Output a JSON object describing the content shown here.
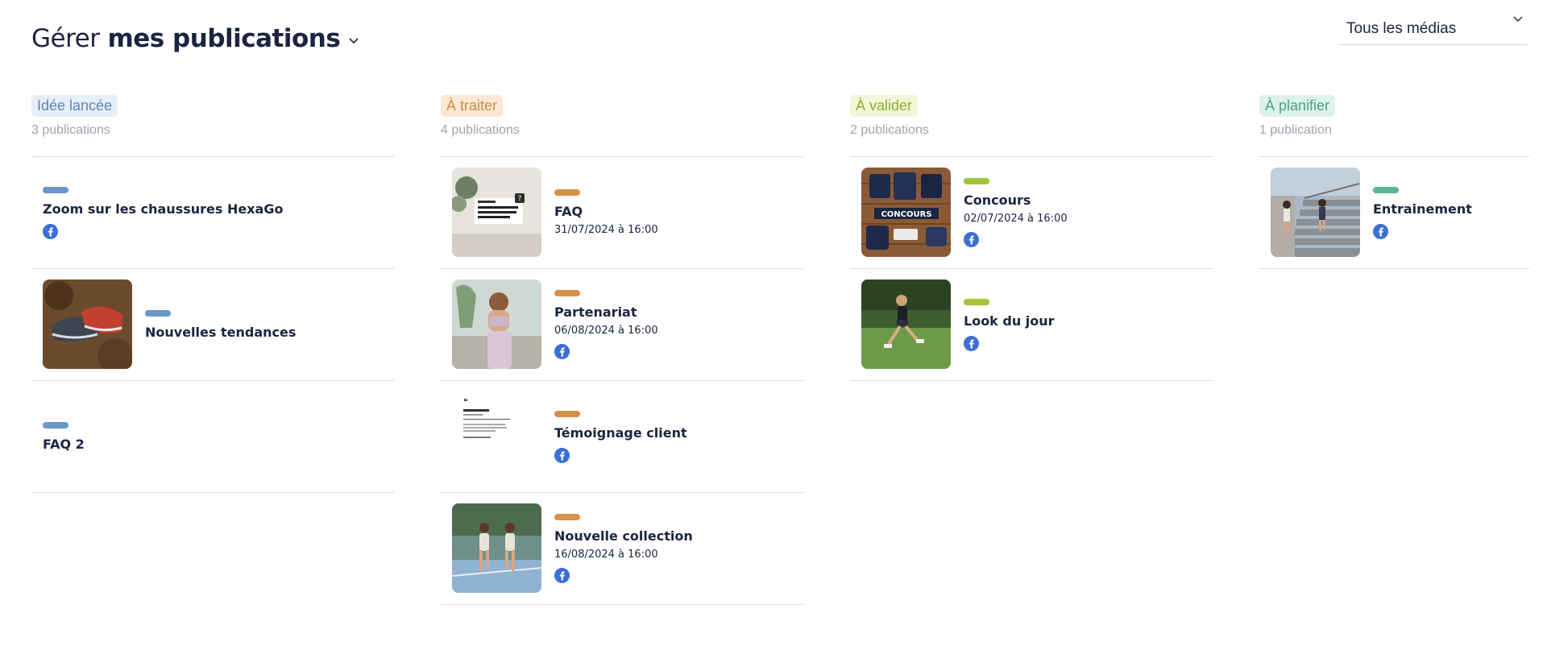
{
  "header": {
    "title_prefix": "Gérer",
    "title_bold": "mes publications",
    "chevron_icon": "chevron-down-icon"
  },
  "filter": {
    "selected": "Tous les médias",
    "chevron_icon": "chevron-down-icon"
  },
  "colors": {
    "text": "#1b2440",
    "muted": "#a0a4ac",
    "facebook": "#3b6fd6"
  },
  "columns": [
    {
      "tag": "Idée lancée",
      "count": "3 publications",
      "tag_bg": "#e6eef8",
      "tag_fg": "#5b86bd",
      "pill": "#6a96c8",
      "cards": [
        {
          "title": "Zoom sur les chaussures HexaGo",
          "date": "",
          "network_icon": "facebook-icon",
          "thumb": ""
        },
        {
          "title": "Nouvelles tendances",
          "date": "",
          "network_icon": "",
          "thumb": "shoes"
        },
        {
          "title": "FAQ 2",
          "date": "",
          "network_icon": "",
          "thumb": ""
        }
      ]
    },
    {
      "tag": "À traiter",
      "count": "4 publications",
      "tag_bg": "#fbe8d6",
      "tag_fg": "#d08a45",
      "pill": "#d69147",
      "cards": [
        {
          "title": "FAQ",
          "date": "31/07/2024 à 16:00",
          "network_icon": "",
          "thumb": "faq-card"
        },
        {
          "title": "Partenariat",
          "date": "06/08/2024 à 16:00",
          "network_icon": "facebook-icon",
          "thumb": "woman-sport"
        },
        {
          "title": "Témoignage client",
          "date": "",
          "network_icon": "facebook-icon",
          "thumb": "client-feedback"
        },
        {
          "title": "Nouvelle collection",
          "date": "16/08/2024 à 16:00",
          "network_icon": "facebook-icon",
          "thumb": "runners-track"
        }
      ]
    },
    {
      "tag": "À valider",
      "count": "2 publications",
      "tag_bg": "#f1f6d9",
      "tag_fg": "#8fae2a",
      "pill": "#a5c43a",
      "cards": [
        {
          "title": "Concours",
          "date": "02/07/2024 à 16:00",
          "network_icon": "facebook-icon",
          "thumb": "concours"
        },
        {
          "title": "Look du jour",
          "date": "",
          "network_icon": "facebook-icon",
          "thumb": "runner-grass"
        }
      ]
    },
    {
      "tag": "À planifier",
      "count": "1 publication",
      "tag_bg": "#dcf2ea",
      "tag_fg": "#4aa184",
      "pill": "#5fb597",
      "cards": [
        {
          "title": "Entrainement",
          "date": "",
          "network_icon": "facebook-icon",
          "thumb": "stairs-run"
        }
      ]
    }
  ]
}
